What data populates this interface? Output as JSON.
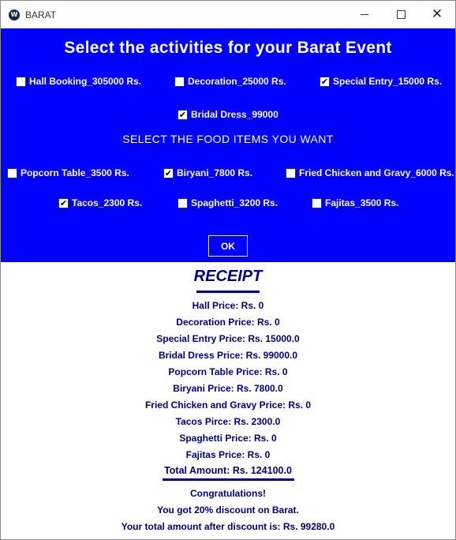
{
  "window": {
    "title": "BARAT",
    "icon_glyph": "W",
    "icon_color": "#0c2e55"
  },
  "header": {
    "title": "Select the activities for your Barat Event",
    "background": "#0000ff"
  },
  "activities": [
    {
      "label": "Hall Booking_305000 Rs.",
      "checked": false
    },
    {
      "label": "Decoration_25000 Rs.",
      "checked": false
    },
    {
      "label": "Special Entry_15000 Rs.",
      "checked": true
    },
    {
      "label": "Bridal Dress_99000",
      "checked": true
    }
  ],
  "food": {
    "title": "SELECT THE FOOD ITEMS YOU WANT",
    "items": [
      {
        "label": "Popcorn Table_3500 Rs.",
        "checked": false
      },
      {
        "label": "Biryani_7800 Rs.",
        "checked": true
      },
      {
        "label": "Fried Chicken and Gravy_6000 Rs.",
        "checked": false
      },
      {
        "label": "Tacos_2300 Rs.",
        "checked": true
      },
      {
        "label": "Spaghetti_3200 Rs.",
        "checked": false
      },
      {
        "label": "Fajitas_3500 Rs.",
        "checked": false
      }
    ]
  },
  "ok_label": "OK",
  "receipt": {
    "title": "RECEIPT",
    "text_color": "#000080",
    "lines": [
      "Hall Price: Rs. 0",
      "Decoration Price: Rs. 0",
      "Special Entry Price: Rs. 15000.0",
      "Bridal Dress Price:  Rs. 99000.0",
      "Popcorn Table Price: Rs. 0",
      "Biryani Price: Rs. 7800.0",
      "Fried Chicken and Gravy Price: Rs. 0",
      "Tacos Pirce: Rs. 2300.0",
      "Spaghetti Price: Rs. 0",
      "Fajitas Price: Rs. 0"
    ],
    "total": "Total Amount: Rs. 124100.0",
    "congrats": "Congratulations!",
    "discount": "You got 20% discount on Barat.",
    "after_discount": "Your total amount after discount is: Rs.  99280.0"
  }
}
